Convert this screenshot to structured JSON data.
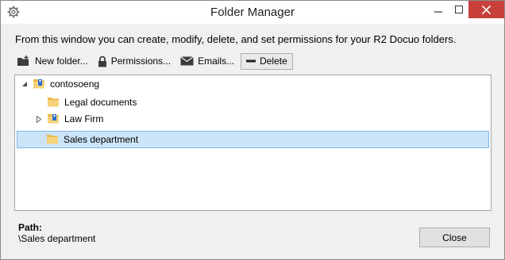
{
  "window": {
    "title": "Folder Manager",
    "accent_close": "#c7413a"
  },
  "description": "From this window you can create, modify, delete, and set permissions for your R2 Docuo folders.",
  "toolbar": {
    "new_folder": "New folder...",
    "permissions": "Permissions...",
    "emails": "Emails...",
    "delete": "Delete"
  },
  "tree": {
    "root": "contosoeng",
    "items": [
      {
        "label": "Legal documents"
      },
      {
        "label": "Law Firm"
      },
      {
        "label": "Sales department"
      }
    ],
    "selected_color": "#cce4f7"
  },
  "path": {
    "label": "Path:",
    "value": "\\Sales department"
  },
  "buttons": {
    "close": "Close"
  }
}
